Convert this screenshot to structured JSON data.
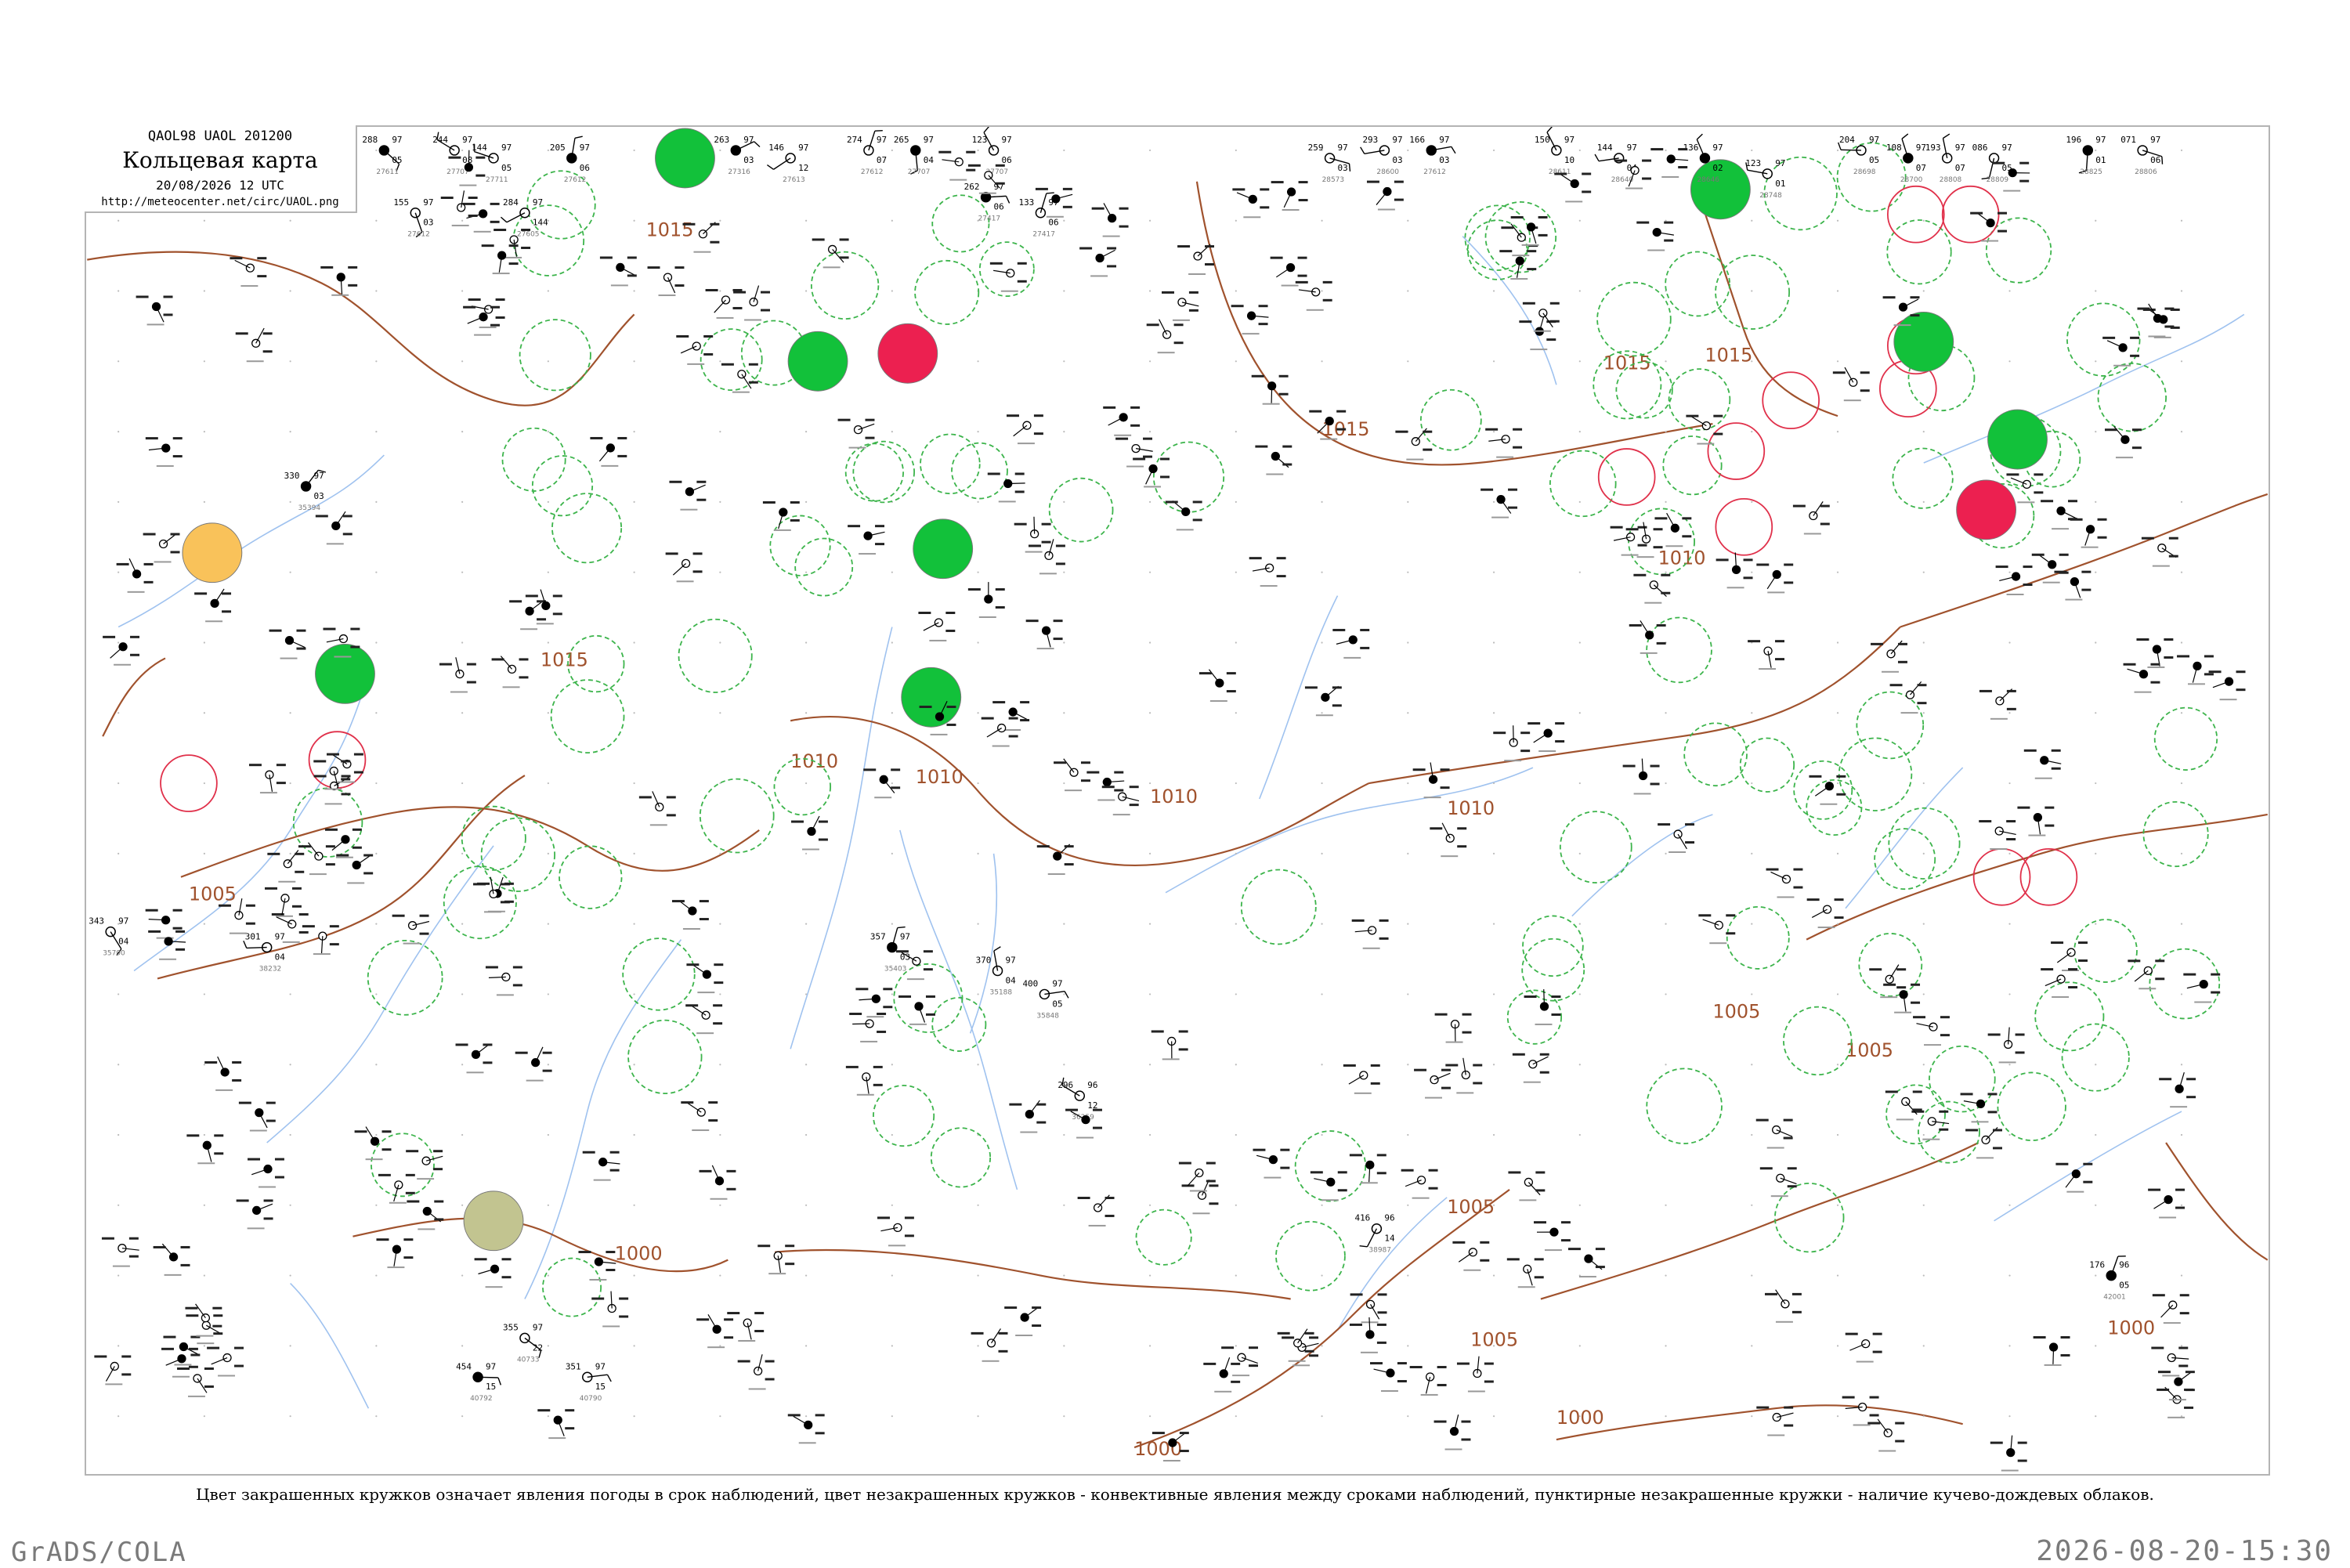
{
  "title_box": {
    "code": "QAOL98  UAOL  201200",
    "title": "Кольцевая карта",
    "datetime": "20/08/2026 12 UTC",
    "url": "http://meteocenter.net/circ/UAOL.png"
  },
  "caption": "Цвет закрашенных кружков означает явления погоды в срок наблюдений, цвет незакрашенных кружков - конвективные явления между сроками наблюдений, пунктирные незакрашенные кружки - наличие кучево-дождевых облаков.",
  "footer": {
    "left": "GrADS/COLA",
    "right": "2026-08-20-15:30"
  },
  "colors": {
    "isobar": "#a0522d",
    "river": "#9fc2ef",
    "frame": "#b4b4b4",
    "cb_ring": "#3cb44b",
    "conv_ring": "#e0304a",
    "fill_green": "#12c13a",
    "fill_red": "#ec2050",
    "fill_orange": "#f9c25a",
    "fill_olive": "#c2c490"
  },
  "isobar_labels": [
    "1015",
    "1015",
    "1015",
    "1015",
    "1015",
    "1010",
    "1010",
    "1010",
    "1010",
    "1010",
    "1005",
    "1005",
    "1005",
    "1005",
    "1005",
    "1000",
    "1000",
    "1000",
    "1000"
  ],
  "stations": [
    {
      "p": "288",
      "t": "97",
      "d": "05",
      "id": "27611"
    },
    {
      "p": "244",
      "t": "97",
      "d": "08",
      "id": "27707"
    },
    {
      "p": "144",
      "t": "97",
      "d": "05",
      "id": "27711"
    },
    {
      "p": "205",
      "t": "97",
      "d": "06",
      "id": "27612"
    },
    {
      "p": "284",
      "t": "97",
      "d": "144",
      "id": "27605"
    },
    {
      "p": "259",
      "t": "97",
      "d": "03",
      "id": "28573"
    },
    {
      "p": "262",
      "t": "97",
      "d": "06",
      "id": "27417"
    },
    {
      "p": "133",
      "t": "97",
      "d": "06",
      "id": "27417"
    },
    {
      "p": "274",
      "t": "97",
      "d": "07",
      "id": "27612"
    },
    {
      "p": "265",
      "t": "97",
      "d": "04",
      "id": "27707"
    },
    {
      "p": "155",
      "t": "97",
      "d": "03",
      "id": "27612"
    },
    {
      "p": "123",
      "t": "97",
      "d": "06",
      "id": "27707"
    },
    {
      "p": "263",
      "t": "97",
      "d": "03",
      "id": "27316"
    },
    {
      "p": "146",
      "t": "97",
      "d": "12",
      "id": "27613"
    },
    {
      "p": "293",
      "t": "97",
      "d": "03",
      "id": "28600"
    },
    {
      "p": "166",
      "t": "97",
      "d": "03",
      "id": "27612"
    },
    {
      "p": "150",
      "t": "97",
      "d": "10",
      "id": "28611"
    },
    {
      "p": "144",
      "t": "97",
      "d": "04",
      "id": "28640"
    },
    {
      "p": "136",
      "t": "97",
      "d": "02",
      "id": "28646"
    },
    {
      "p": "123",
      "t": "97",
      "d": "01",
      "id": "28748"
    },
    {
      "p": "204",
      "t": "97",
      "d": "05",
      "id": "28698"
    },
    {
      "p": "108",
      "t": "97",
      "d": "07",
      "id": "28700"
    },
    {
      "p": "193",
      "t": "97",
      "d": "07",
      "id": "28808"
    },
    {
      "p": "086",
      "t": "97",
      "d": "05",
      "id": "28809"
    },
    {
      "p": "196",
      "t": "97",
      "d": "01",
      "id": "28825"
    },
    {
      "p": "071",
      "t": "97",
      "d": "06",
      "id": "28806"
    },
    {
      "p": "343",
      "t": "97",
      "d": "04",
      "id": "35700"
    },
    {
      "p": "330",
      "t": "97",
      "d": "03",
      "id": "35394"
    },
    {
      "p": "301",
      "t": "97",
      "d": "04",
      "id": "38232"
    },
    {
      "p": "416",
      "t": "96",
      "d": "14",
      "id": "38987"
    },
    {
      "p": "454",
      "t": "97",
      "d": "15",
      "id": "40792"
    },
    {
      "p": "355",
      "t": "97",
      "d": "22",
      "id": "40733"
    },
    {
      "p": "351",
      "t": "97",
      "d": "15",
      "id": "40790"
    },
    {
      "p": "176",
      "t": "96",
      "d": "05",
      "id": "42001"
    },
    {
      "p": "296",
      "t": "96",
      "d": "12",
      "id": "36259"
    },
    {
      "p": "400",
      "t": "97",
      "d": "05",
      "id": "35848"
    },
    {
      "p": "357",
      "t": "97",
      "d": "03",
      "id": "35403"
    },
    {
      "p": "370",
      "t": "97",
      "d": "04",
      "id": "35188"
    }
  ],
  "present_weather": [
    {
      "color": "green"
    },
    {
      "color": "green"
    },
    {
      "color": "green"
    },
    {
      "color": "green"
    },
    {
      "color": "green"
    },
    {
      "color": "green"
    },
    {
      "color": "green"
    },
    {
      "color": "green"
    },
    {
      "color": "red"
    },
    {
      "color": "red"
    },
    {
      "color": "orange"
    },
    {
      "color": "olive"
    }
  ],
  "cb_ring_count": 95,
  "conv_ring_count": 12
}
